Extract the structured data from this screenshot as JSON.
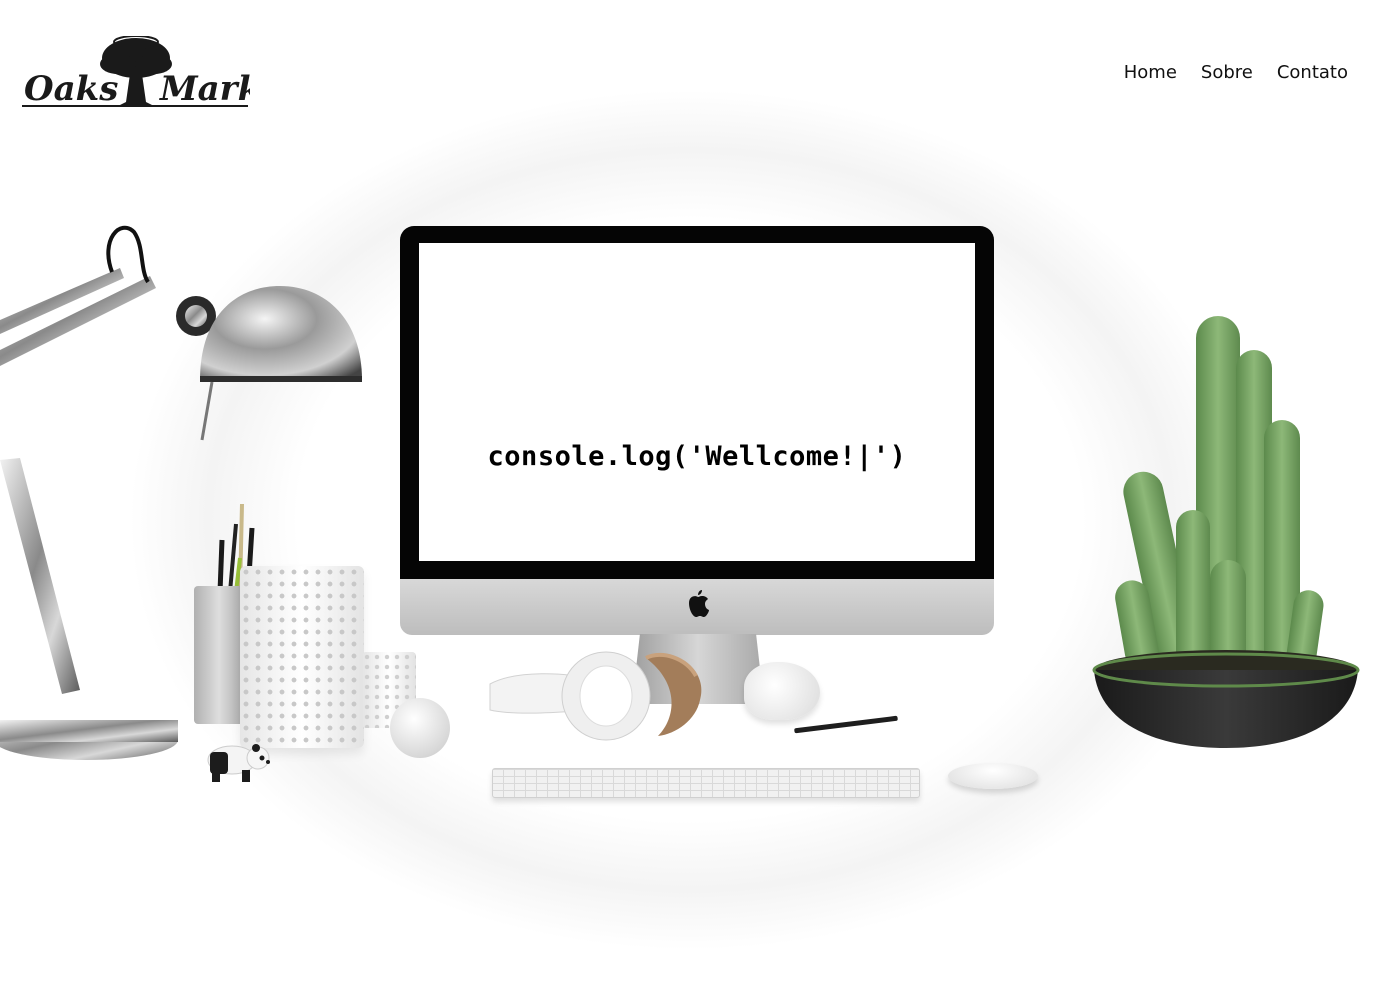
{
  "header": {
    "logo": {
      "text_left": "Oaks",
      "text_right": "Mark",
      "icon": "oak-tree-icon"
    },
    "nav": [
      {
        "label": "Home"
      },
      {
        "label": "Sobre"
      },
      {
        "label": "Contato"
      }
    ]
  },
  "hero": {
    "console_text": "console.log('Wellcome!|')",
    "monitor_logo_icon": "apple-logo-icon"
  },
  "colors": {
    "background": "#ffffff",
    "text": "#111111",
    "cactus_green": "#7fa66a",
    "pot": "#2b2b2b"
  }
}
